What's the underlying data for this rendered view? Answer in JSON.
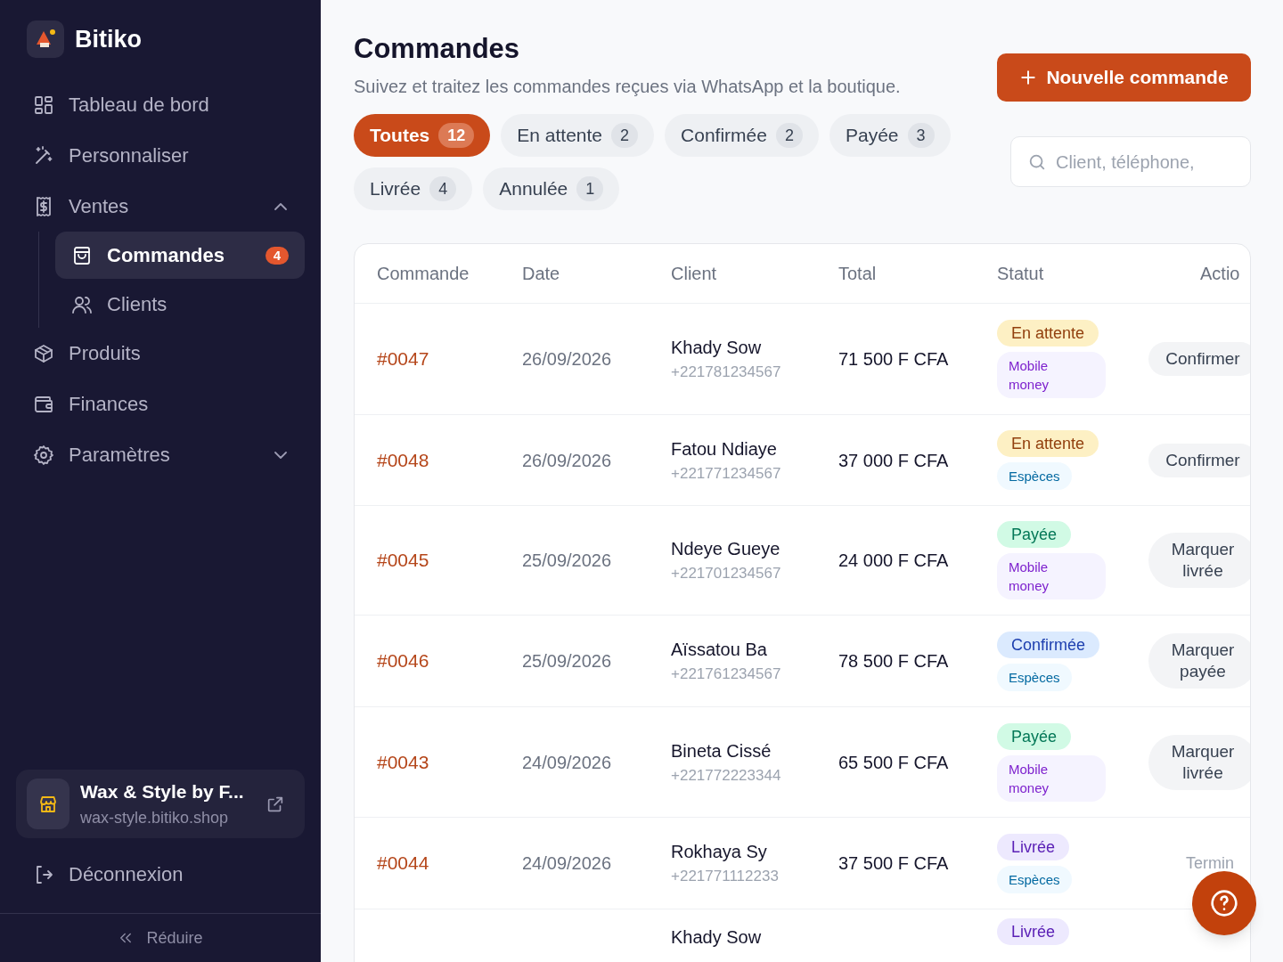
{
  "brand": {
    "name": "Bitiko"
  },
  "sidebar": {
    "items": [
      {
        "label": "Tableau de bord",
        "selected": false
      },
      {
        "label": "Personnaliser",
        "selected": false
      },
      {
        "label": "Ventes",
        "selected": false,
        "expanded": true,
        "children": [
          {
            "label": "Commandes",
            "selected": true,
            "badge": "4"
          },
          {
            "label": "Clients",
            "selected": false
          }
        ]
      },
      {
        "label": "Produits",
        "selected": false
      },
      {
        "label": "Finances",
        "selected": false
      },
      {
        "label": "Paramètres",
        "selected": false,
        "expanded": false
      }
    ],
    "store": {
      "name": "Wax & Style by F...",
      "url": "wax-style.bitiko.shop"
    },
    "logout": "Déconnexion",
    "collapse": "Réduire"
  },
  "page": {
    "title": "Commandes",
    "subtitle": "Suivez et traitez les commandes reçues via WhatsApp et la boutique.",
    "new_button": "Nouvelle commande",
    "filters": [
      {
        "label": "Toutes",
        "count": "12",
        "selected": true
      },
      {
        "label": "En attente",
        "count": "2",
        "selected": false
      },
      {
        "label": "Confirmée",
        "count": "2",
        "selected": false
      },
      {
        "label": "Payée",
        "count": "3",
        "selected": false
      },
      {
        "label": "Livrée",
        "count": "4",
        "selected": false
      },
      {
        "label": "Annulée",
        "count": "1",
        "selected": false
      }
    ],
    "search": {
      "placeholder": "Client, téléphone,"
    }
  },
  "table": {
    "columns": [
      "Commande",
      "Date",
      "Client",
      "Total",
      "Statut",
      "Actio"
    ],
    "rows": [
      {
        "order": "#0047",
        "date": "26/09/2026",
        "client": "Khady Sow",
        "phone": "+221781234567",
        "total": "71 500 F CFA",
        "status": {
          "label": "En attente",
          "kind": "pending"
        },
        "payment": {
          "label": "Mobile money",
          "kind": "mobile"
        },
        "action": {
          "label": "Confirmer",
          "kind": "button"
        }
      },
      {
        "order": "#0048",
        "date": "26/09/2026",
        "client": "Fatou Ndiaye",
        "phone": "+221771234567",
        "total": "37 000 F CFA",
        "status": {
          "label": "En attente",
          "kind": "pending"
        },
        "payment": {
          "label": "Espèces",
          "kind": "cash"
        },
        "action": {
          "label": "Confirmer",
          "kind": "button"
        }
      },
      {
        "order": "#0045",
        "date": "25/09/2026",
        "client": "Ndeye Gueye",
        "phone": "+221701234567",
        "total": "24 000 F CFA",
        "status": {
          "label": "Payée",
          "kind": "paid"
        },
        "payment": {
          "label": "Mobile money",
          "kind": "mobile"
        },
        "action": {
          "label": "Marquer livrée",
          "kind": "button"
        }
      },
      {
        "order": "#0046",
        "date": "25/09/2026",
        "client": "Aïssatou Ba",
        "phone": "+221761234567",
        "total": "78 500 F CFA",
        "status": {
          "label": "Confirmée",
          "kind": "confirmed"
        },
        "payment": {
          "label": "Espèces",
          "kind": "cash"
        },
        "action": {
          "label": "Marquer payée",
          "kind": "button"
        }
      },
      {
        "order": "#0043",
        "date": "24/09/2026",
        "client": "Bineta Cissé",
        "phone": "+221772223344",
        "total": "65 500 F CFA",
        "status": {
          "label": "Payée",
          "kind": "paid"
        },
        "payment": {
          "label": "Mobile money",
          "kind": "mobile"
        },
        "action": {
          "label": "Marquer livrée",
          "kind": "button"
        }
      },
      {
        "order": "#0044",
        "date": "24/09/2026",
        "client": "Rokhaya Sy",
        "phone": "+221771112233",
        "total": "37 500 F CFA",
        "status": {
          "label": "Livrée",
          "kind": "delivered"
        },
        "payment": {
          "label": "Espèces",
          "kind": "cash"
        },
        "action": {
          "label": "Termin",
          "kind": "text"
        }
      },
      {
        "client": "Khady Sow",
        "status": {
          "label": "Livrée",
          "kind": "delivered"
        }
      }
    ]
  }
}
